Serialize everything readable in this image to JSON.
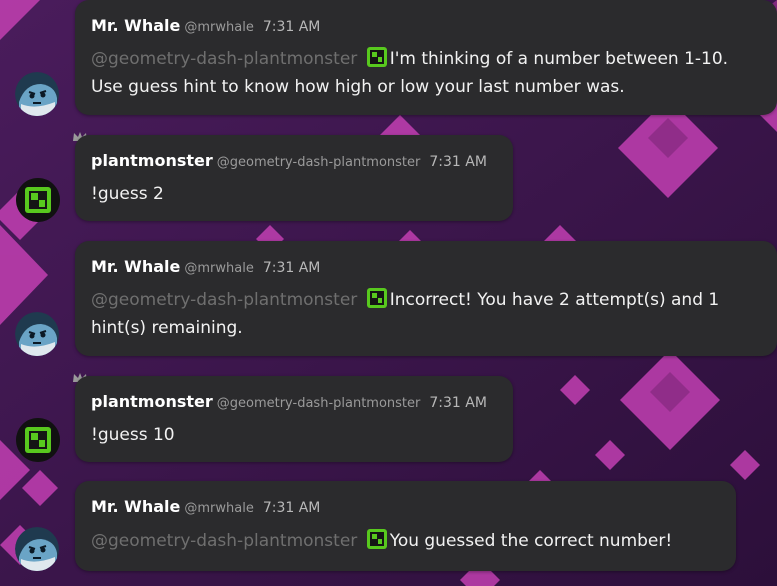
{
  "colors": {
    "background": "#3a1747",
    "bubble": "#2b2b2d",
    "accent_pink": "#c23fb2",
    "mention": "#6f6f6f",
    "plant_green": "#58c91e"
  },
  "icons": {
    "crown": "crown-icon",
    "whale_avatar": "whale-avatar-icon",
    "plant_avatar": "plantmonster-avatar-icon"
  },
  "messages": [
    {
      "author": "Mr. Whale",
      "handle": "@mrwhale",
      "time": "7:31 AM",
      "mention": "@geometry-dash-plantmonster",
      "text": "I'm thinking of a number between 1-10. Use guess hint to know how high or low your last number was."
    },
    {
      "author": "plantmonster",
      "handle": "@geometry-dash-plantmonster",
      "time": "7:31 AM",
      "text": "!guess 2"
    },
    {
      "author": "Mr. Whale",
      "handle": "@mrwhale",
      "time": "7:31 AM",
      "mention": "@geometry-dash-plantmonster",
      "text": "Incorrect! You have 2 attempt(s) and 1 hint(s) remaining."
    },
    {
      "author": "plantmonster",
      "handle": "@geometry-dash-plantmonster",
      "time": "7:31 AM",
      "text": "!guess 10"
    },
    {
      "author": "Mr. Whale",
      "handle": "@mrwhale",
      "time": "7:31 AM",
      "mention": "@geometry-dash-plantmonster",
      "text": "You guessed the correct number!"
    }
  ]
}
